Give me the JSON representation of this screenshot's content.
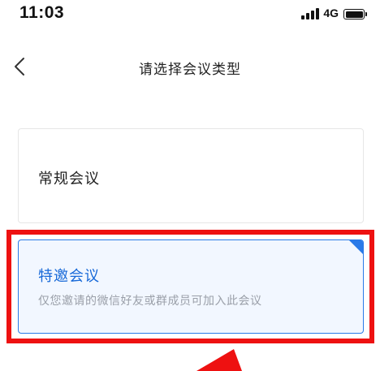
{
  "status_bar": {
    "time": "11:03",
    "network": "4G"
  },
  "nav": {
    "title": "请选择会议类型"
  },
  "options": [
    {
      "title": "常规会议"
    },
    {
      "title": "特邀会议",
      "description": "仅您邀请的微信好友或群成员可加入此会议"
    }
  ],
  "colors": {
    "accent": "#2a7ae8",
    "highlight": "#ee1111"
  }
}
